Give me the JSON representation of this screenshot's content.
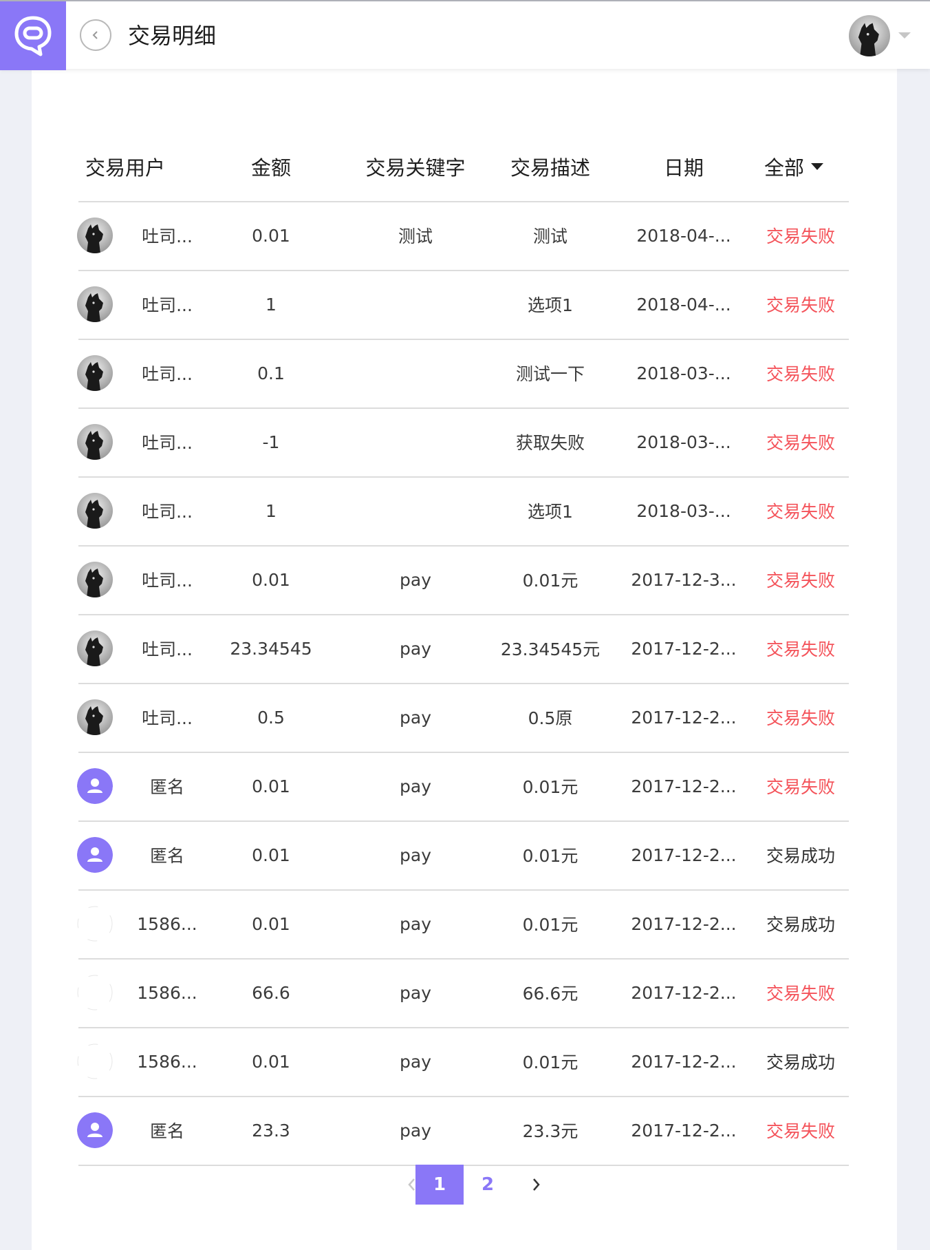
{
  "header": {
    "title": "交易明细"
  },
  "table": {
    "columns": [
      "交易用户",
      "金额",
      "交易关键字",
      "交易描述",
      "日期",
      "全部"
    ],
    "rows": [
      {
        "avatar": "dog",
        "user": "吐司...",
        "amount": "0.01",
        "keyword": "测试",
        "desc": "测试",
        "date": "2018-04-...",
        "status": "交易失败",
        "status_type": "fail"
      },
      {
        "avatar": "dog",
        "user": "吐司...",
        "amount": "1",
        "keyword": "",
        "desc": "选项1",
        "date": "2018-04-...",
        "status": "交易失败",
        "status_type": "fail"
      },
      {
        "avatar": "dog",
        "user": "吐司...",
        "amount": "0.1",
        "keyword": "",
        "desc": "测试一下",
        "date": "2018-03-...",
        "status": "交易失败",
        "status_type": "fail"
      },
      {
        "avatar": "dog",
        "user": "吐司...",
        "amount": "-1",
        "keyword": "",
        "desc": "获取失败",
        "date": "2018-03-...",
        "status": "交易失败",
        "status_type": "fail"
      },
      {
        "avatar": "dog",
        "user": "吐司...",
        "amount": "1",
        "keyword": "",
        "desc": "选项1",
        "date": "2018-03-...",
        "status": "交易失败",
        "status_type": "fail"
      },
      {
        "avatar": "dog",
        "user": "吐司...",
        "amount": "0.01",
        "keyword": "pay",
        "desc": "0.01元",
        "date": "2017-12-3...",
        "status": "交易失败",
        "status_type": "fail"
      },
      {
        "avatar": "dog",
        "user": "吐司...",
        "amount": "23.34545",
        "keyword": "pay",
        "desc": "23.34545元",
        "date": "2017-12-2...",
        "status": "交易失败",
        "status_type": "fail"
      },
      {
        "avatar": "dog",
        "user": "吐司...",
        "amount": "0.5",
        "keyword": "pay",
        "desc": "0.5原",
        "date": "2017-12-2...",
        "status": "交易失败",
        "status_type": "fail"
      },
      {
        "avatar": "anon",
        "user": "匿名",
        "amount": "0.01",
        "keyword": "pay",
        "desc": "0.01元",
        "date": "2017-12-2...",
        "status": "交易失败",
        "status_type": "fail"
      },
      {
        "avatar": "anon",
        "user": "匿名",
        "amount": "0.01",
        "keyword": "pay",
        "desc": "0.01元",
        "date": "2017-12-2...",
        "status": "交易成功",
        "status_type": "ok"
      },
      {
        "avatar": "blank",
        "user": "1586...",
        "amount": "0.01",
        "keyword": "pay",
        "desc": "0.01元",
        "date": "2017-12-2...",
        "status": "交易成功",
        "status_type": "ok"
      },
      {
        "avatar": "blank",
        "user": "1586...",
        "amount": "66.6",
        "keyword": "pay",
        "desc": "66.6元",
        "date": "2017-12-2...",
        "status": "交易失败",
        "status_type": "fail"
      },
      {
        "avatar": "blank",
        "user": "1586...",
        "amount": "0.01",
        "keyword": "pay",
        "desc": "0.01元",
        "date": "2017-12-2...",
        "status": "交易成功",
        "status_type": "ok"
      },
      {
        "avatar": "anon",
        "user": "匿名",
        "amount": "23.3",
        "keyword": "pay",
        "desc": "23.3元",
        "date": "2017-12-2...",
        "status": "交易失败",
        "status_type": "fail"
      }
    ]
  },
  "pagination": {
    "pages": [
      "1",
      "2"
    ],
    "current": "1",
    "prev_icon": "chevron-left-icon",
    "next_icon": "chevron-right-icon"
  },
  "colors": {
    "accent": "#8a77f7",
    "fail": "#f4535a",
    "text": "#3b3b3b"
  }
}
